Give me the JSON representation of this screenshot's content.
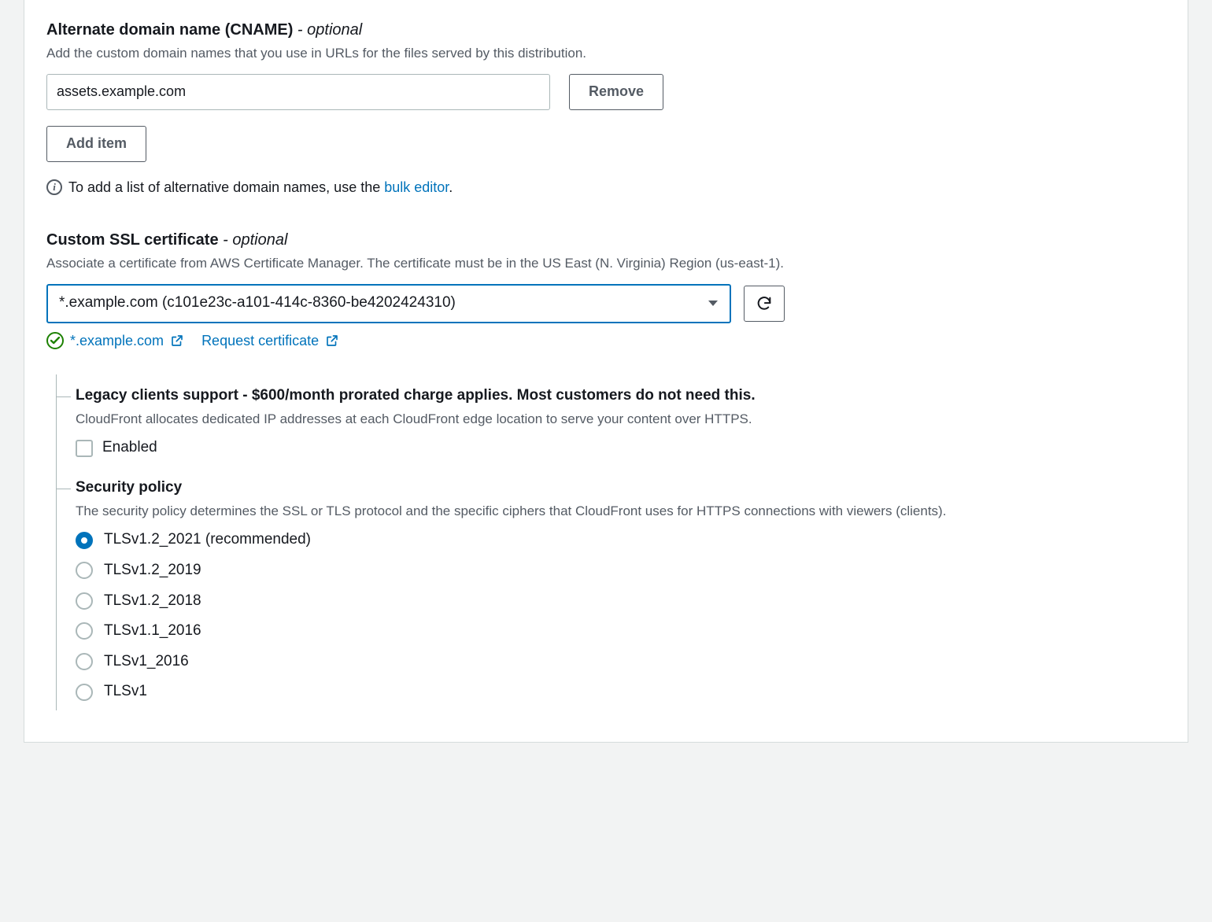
{
  "cname": {
    "label": "Alternate domain name (CNAME)",
    "optional": " - optional",
    "desc": "Add the custom domain names that you use in URLs for the files served by this distribution.",
    "value": "assets.example.com",
    "remove": "Remove",
    "add": "Add item",
    "hint_prefix": "To add a list of alternative domain names, use the ",
    "hint_link": "bulk editor",
    "hint_suffix": "."
  },
  "ssl": {
    "label": "Custom SSL certificate",
    "optional": " - optional",
    "desc": "Associate a certificate from AWS Certificate Manager. The certificate must be in the US East (N. Virginia) Region (us-east-1).",
    "selected": "*.example.com (c101e23c-a101-414c-8360-be4202424310)",
    "validated_domain": "*.example.com",
    "request_link": "Request certificate"
  },
  "legacy": {
    "label": "Legacy clients support - $600/month prorated charge applies. Most customers do not need this.",
    "desc": "CloudFront allocates dedicated IP addresses at each CloudFront edge location to serve your content over HTTPS.",
    "checkbox": "Enabled"
  },
  "policy": {
    "label": "Security policy",
    "desc": "The security policy determines the SSL or TLS protocol and the specific ciphers that CloudFront uses for HTTPS connections with viewers (clients).",
    "options": [
      "TLSv1.2_2021 (recommended)",
      "TLSv1.2_2019",
      "TLSv1.2_2018",
      "TLSv1.1_2016",
      "TLSv1_2016",
      "TLSv1"
    ],
    "selected_index": 0
  }
}
